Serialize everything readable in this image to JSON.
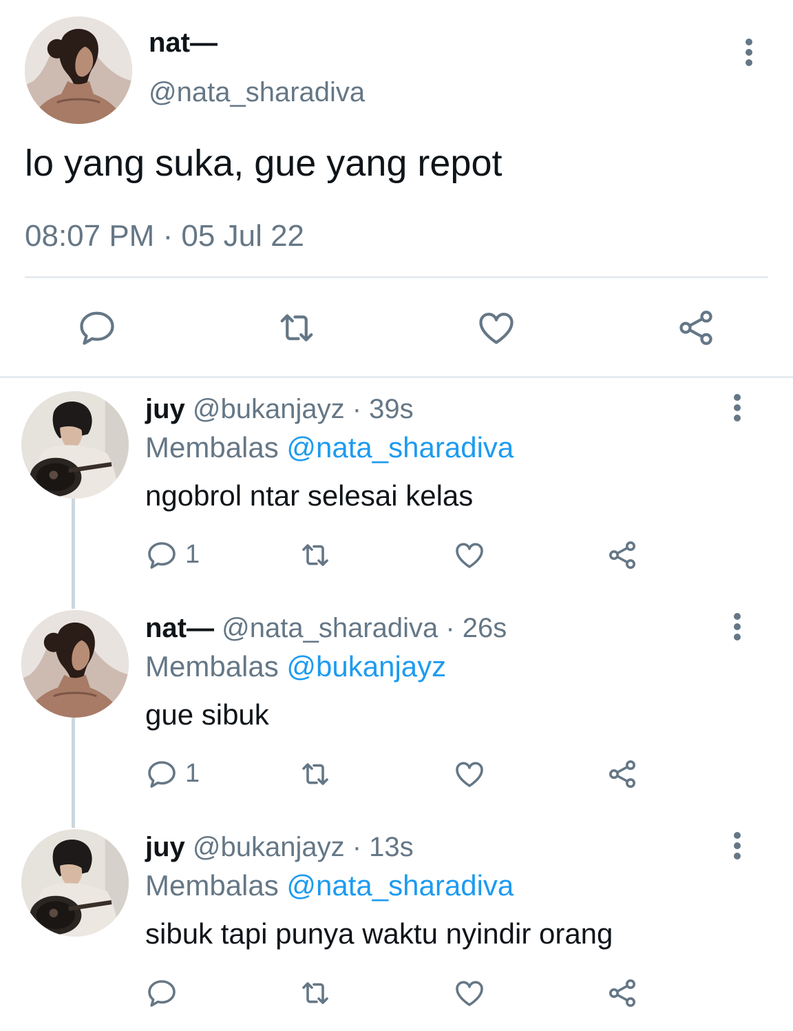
{
  "main_tweet": {
    "display_name": "nat—",
    "handle": "@nata_sharadiva",
    "text": "lo yang suka, gue yang repot",
    "timestamp": "08:07 PM · 05 Jul 22",
    "actions": [
      "reply-icon",
      "retweet-icon",
      "like-icon",
      "share-icon"
    ]
  },
  "replies": [
    {
      "display_name": "juy",
      "handle_time": " @bukanjayz · 39s",
      "replying_prefix": "Membalas ",
      "replying_to": "@nata_sharadiva",
      "text": "ngobrol ntar selesai kelas",
      "reply_count": "1"
    },
    {
      "display_name": "nat—",
      "handle_time": " @nata_sharadiva · 26s",
      "replying_prefix": "Membalas ",
      "replying_to": "@bukanjayz",
      "text": "gue sibuk",
      "reply_count": "1"
    },
    {
      "display_name": "juy",
      "handle_time": " @bukanjayz · 13s",
      "replying_prefix": "Membalas ",
      "replying_to": "@nata_sharadiva",
      "text": "sibuk tapi punya waktu nyindir orang",
      "reply_count": ""
    }
  ],
  "colors": {
    "text_primary": "#0f1419",
    "text_secondary": "#657786",
    "mention": "#1d9bf0",
    "divider": "#e6ecf0",
    "thread_line": "#ccd6dd"
  }
}
